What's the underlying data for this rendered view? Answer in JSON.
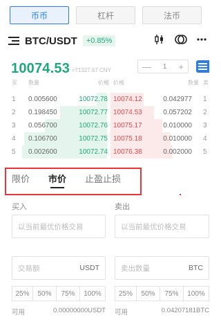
{
  "tabs": [
    {
      "label": "币币",
      "active": true
    },
    {
      "label": "杠杆",
      "active": false
    },
    {
      "label": "法币",
      "active": false
    }
  ],
  "pair": {
    "name": "BTC/USDT",
    "change": "+0.85%"
  },
  "ticker": {
    "last_price": "10074.53",
    "cny_price": "≈71327.67 CNY"
  },
  "depth": {
    "minus": "—",
    "value": "1",
    "plus": "+"
  },
  "orderbook": {
    "headers": {
      "buy_idx": "买",
      "buy_qty": "数量",
      "buy_price": "价格",
      "sell_price": "价格",
      "sell_qty": "数量",
      "sell_idx": "卖"
    },
    "rows": [
      {
        "idx": "1",
        "bid_qty": "0.005600",
        "bid_price": "10072.78",
        "ask_price": "10074.12",
        "ask_qty": "0.042977",
        "ask_idx": "1",
        "bid_depth": 0.1,
        "ask_depth": 0.32
      },
      {
        "idx": "2",
        "bid_qty": "0.198450",
        "bid_price": "10072.77",
        "ask_price": "10074.53",
        "ask_qty": "0.057202",
        "ask_idx": "2",
        "bid_depth": 0.45,
        "ask_depth": 0.42
      },
      {
        "idx": "3",
        "bid_qty": "0.056700",
        "bid_price": "10072.76",
        "ask_price": "10075.17",
        "ask_qty": "0.010000",
        "ask_idx": "3",
        "bid_depth": 0.6,
        "ask_depth": 0.5
      },
      {
        "idx": "4",
        "bid_qty": "0.106700",
        "bid_price": "10072.75",
        "ask_price": "10075.18",
        "ask_qty": "0.010000",
        "ask_idx": "4",
        "bid_depth": 0.8,
        "ask_depth": 0.58
      },
      {
        "idx": "5",
        "bid_qty": "0.002600",
        "bid_price": "10072.74",
        "ask_price": "10076.38",
        "ask_qty": "0.002000",
        "ask_idx": "5",
        "bid_depth": 0.82,
        "ask_depth": 0.6
      }
    ]
  },
  "order_tabs": [
    {
      "label": "限价",
      "active": false
    },
    {
      "label": "市价",
      "active": true
    },
    {
      "label": "止盈止损",
      "active": false
    }
  ],
  "buy": {
    "label": "买入",
    "price_placeholder": "以当前最优价格交易",
    "amount_placeholder": "交易额",
    "amount_unit": "USDT",
    "percents": [
      "25%",
      "50%",
      "75%",
      "100%"
    ],
    "available_label": "可用",
    "available_value": "0.00000000USDT"
  },
  "sell": {
    "label": "卖出",
    "price_placeholder": "以当前最优价格交易",
    "amount_placeholder": "卖出数量",
    "amount_unit": "BTC",
    "percents": [
      "25%",
      "50%",
      "75%",
      "100%"
    ],
    "available_label": "可用",
    "available_value": "0.04207181BTC"
  },
  "colors": {
    "accent": "#2a7de1",
    "up": "#1fa97a",
    "down": "#e24a4a",
    "highlight": "#e8333a"
  }
}
